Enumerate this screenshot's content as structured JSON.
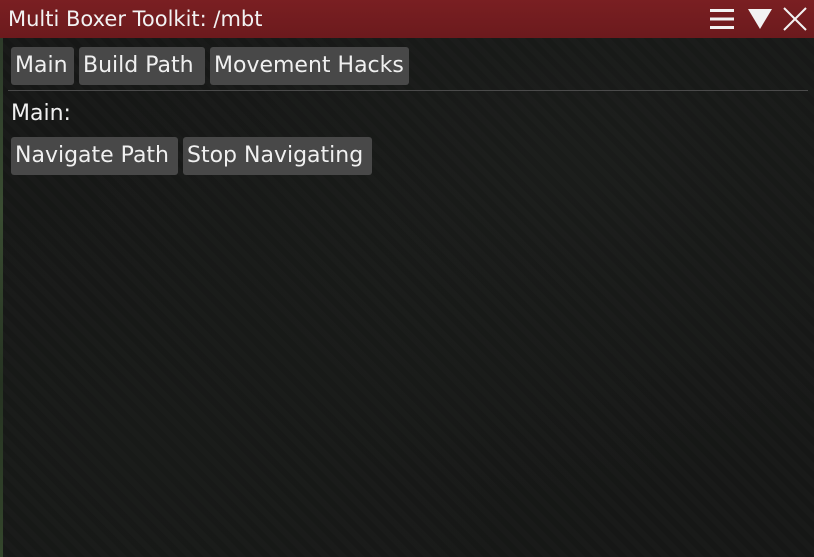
{
  "window": {
    "title": "Multi Boxer Toolkit: /mbt",
    "controls": {
      "menu_icon": "hamburger-icon",
      "collapse_icon": "triangle-down-icon",
      "close_icon": "close-icon"
    },
    "accent_color": "#751d20"
  },
  "tabs": [
    {
      "label": "Main"
    },
    {
      "label": "Build Path"
    },
    {
      "label": "Movement Hacks"
    }
  ],
  "main": {
    "section_label": "Main:",
    "buttons": [
      {
        "label": "Navigate Path"
      },
      {
        "label": "Stop Navigating"
      }
    ]
  }
}
